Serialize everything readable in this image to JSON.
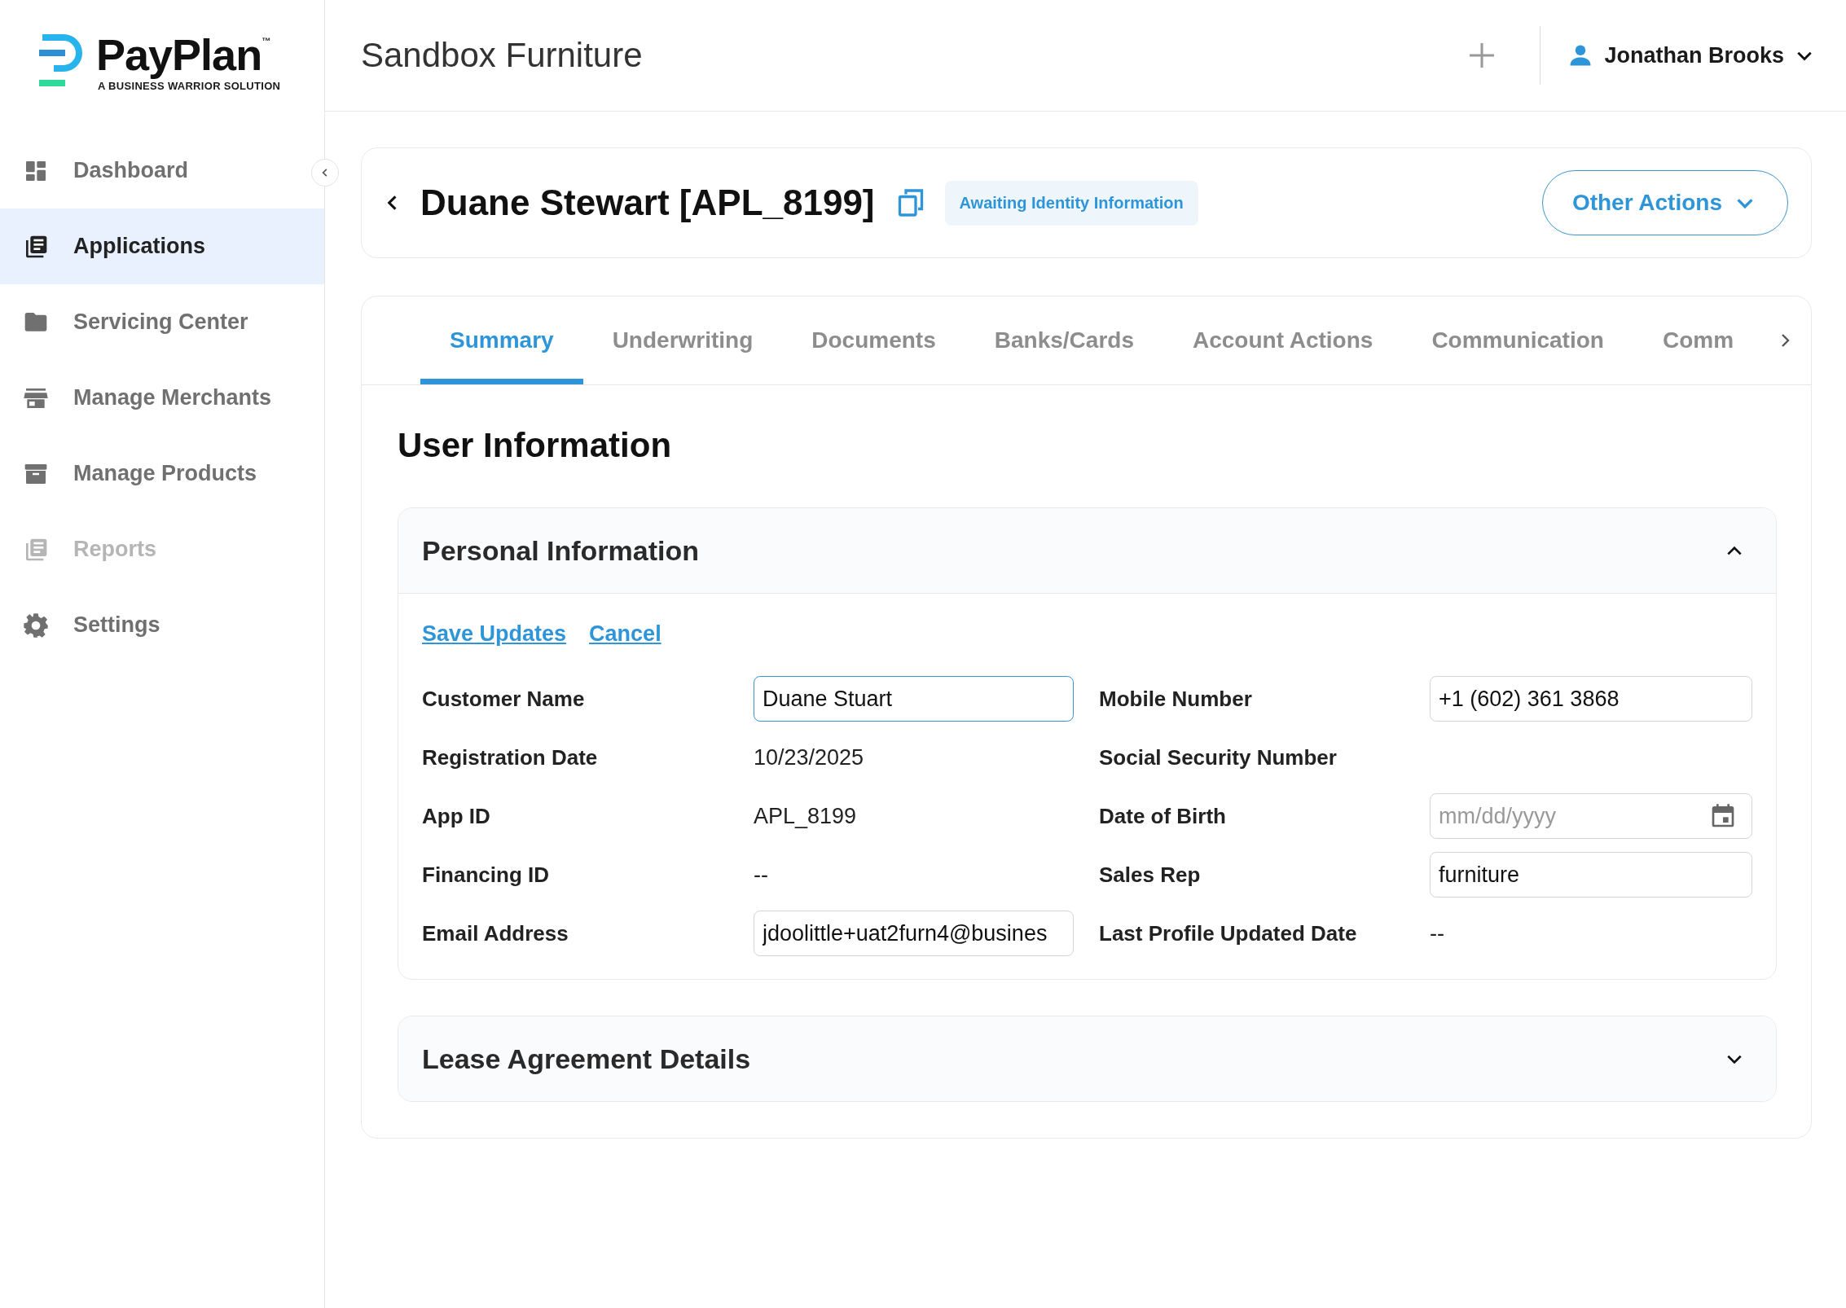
{
  "logo": {
    "name": "PayPlan",
    "trademark": "™",
    "tagline": "A BUSINESS WARRIOR SOLUTION"
  },
  "sidebar": {
    "items": [
      {
        "label": "Dashboard",
        "selected": false,
        "disabled": false
      },
      {
        "label": "Applications",
        "selected": true,
        "disabled": false
      },
      {
        "label": "Servicing Center",
        "selected": false,
        "disabled": false
      },
      {
        "label": "Manage Merchants",
        "selected": false,
        "disabled": false
      },
      {
        "label": "Manage Products",
        "selected": false,
        "disabled": false
      },
      {
        "label": "Reports",
        "selected": false,
        "disabled": true
      },
      {
        "label": "Settings",
        "selected": false,
        "disabled": false
      }
    ]
  },
  "header": {
    "title": "Sandbox Furniture",
    "user": "Jonathan Brooks"
  },
  "application": {
    "title": "Duane Stewart [APL_8199]",
    "status": "Awaiting Identity Information",
    "actions_button": "Other Actions"
  },
  "tabs": [
    {
      "label": "Summary",
      "selected": true
    },
    {
      "label": "Underwriting",
      "selected": false
    },
    {
      "label": "Documents",
      "selected": false
    },
    {
      "label": "Banks/Cards",
      "selected": false
    },
    {
      "label": "Account Actions",
      "selected": false
    },
    {
      "label": "Communication",
      "selected": false
    },
    {
      "label": "Comm",
      "selected": false
    }
  ],
  "section_title": "User Information",
  "panels": [
    {
      "title": "Personal Information",
      "expanded": true,
      "links": [
        "Save Updates",
        "Cancel"
      ],
      "fields": [
        {
          "label": "Customer Name",
          "kind": "input",
          "value": "Duane Stuart",
          "focused": true
        },
        {
          "label": "Mobile Number",
          "kind": "input",
          "value": "+1 (602) 361 3868",
          "focused": false
        },
        {
          "label": "Registration Date",
          "kind": "text",
          "value": "10/23/2025"
        },
        {
          "label": "Social Security Number",
          "kind": "text"
        },
        {
          "label": "App ID",
          "kind": "text",
          "value": "APL_8199"
        },
        {
          "label": "Date of Birth",
          "kind": "date",
          "placeholder": "mm/dd/yyyy"
        },
        {
          "label": "Financing ID",
          "kind": "text",
          "value": "--"
        },
        {
          "label": "Sales Rep",
          "kind": "input",
          "value": "furniture",
          "focused": false
        },
        {
          "label": "Email Address",
          "kind": "input",
          "value": "jdoolittle+uat2furn4@busines",
          "focused": false
        },
        {
          "label": "Last Profile Updated Date",
          "kind": "text",
          "value": "--"
        }
      ]
    },
    {
      "title": "Lease Agreement Details",
      "expanded": false
    }
  ]
}
